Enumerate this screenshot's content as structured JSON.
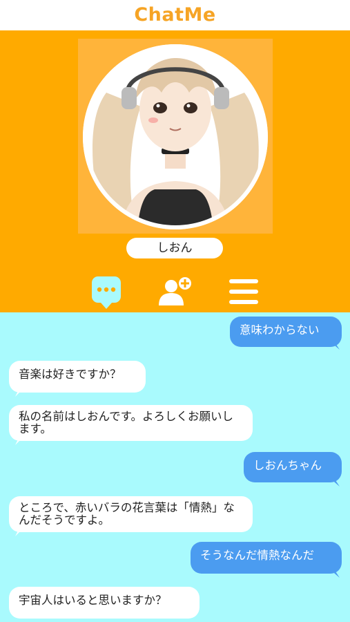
{
  "app": {
    "title": "ChatMe"
  },
  "profile": {
    "name": "しおん"
  },
  "nav": {
    "chat_icon": "chat-bubble-icon",
    "add_icon": "add-friend-icon",
    "menu_icon": "menu-icon"
  },
  "colors": {
    "header": "#ffaa00",
    "chat_bg": "#a9fafd",
    "user_bubble": "#4b9cf0",
    "bot_bubble": "#ffffff",
    "title": "#f6a425"
  },
  "messages": [
    {
      "sender": "user",
      "text": "意味わからない"
    },
    {
      "sender": "bot",
      "text": "音楽は好きですか？"
    },
    {
      "sender": "bot",
      "text": "私の名前はしおんです。よろしくお願いします。"
    },
    {
      "sender": "user",
      "text": "しおんちゃん"
    },
    {
      "sender": "bot",
      "text": "ところで、赤いバラの花言葉は「情熱」なんだそうですよ。"
    },
    {
      "sender": "user",
      "text": "そうなんだ情熱なんだ"
    },
    {
      "sender": "bot",
      "text": "宇宙人はいると思いますか？"
    }
  ]
}
